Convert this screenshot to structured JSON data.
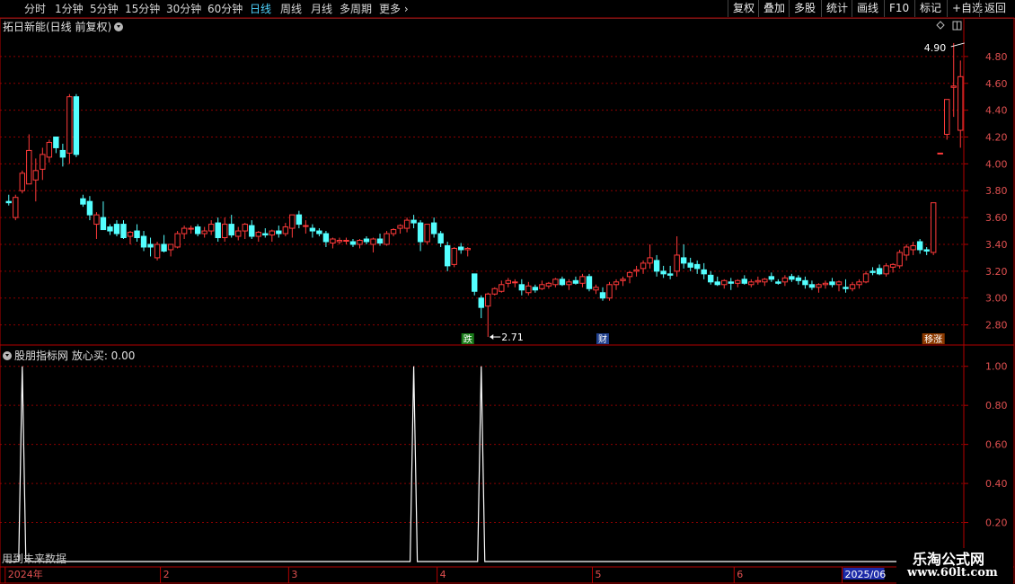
{
  "toolbar": {
    "periods": [
      {
        "label": "分时",
        "active": false
      },
      {
        "label": "1分钟",
        "active": false
      },
      {
        "label": "5分钟",
        "active": false
      },
      {
        "label": "15分钟",
        "active": false
      },
      {
        "label": "30分钟",
        "active": false
      },
      {
        "label": "60分钟",
        "active": false
      },
      {
        "label": "日线",
        "active": true
      },
      {
        "label": "周线",
        "active": false
      },
      {
        "label": "月线",
        "active": false
      },
      {
        "label": "多周期",
        "active": false
      },
      {
        "label": "更多",
        "active": false
      }
    ],
    "buttons": [
      "复权",
      "叠加",
      "多股",
      "统计",
      "画线",
      "F10",
      "标记",
      "+自选",
      "返回"
    ]
  },
  "stock": {
    "title": "拓日新能(日线 前复权)"
  },
  "indicator": {
    "title": "股朋指标网  放心买: 0.00"
  },
  "future_data_label": "用到未来数据",
  "watermark": {
    "name": "乐淘公式网",
    "url": "www.60lt.com"
  },
  "colors": {
    "up": "#ff3a3a",
    "down": "#54ffff",
    "grid": "#8b0000",
    "axis": "#b40000",
    "text": "#e05050",
    "white": "#ffffff"
  },
  "events": [
    {
      "label": "跌",
      "bg": "#1a7d1a",
      "color": "#ffffff",
      "index": 68
    },
    {
      "label": "财",
      "bg": "#1f3f8c",
      "color": "#ffffff",
      "index": 88
    },
    {
      "label": "移涨",
      "bg": "#8c3a00",
      "color": "#ffffff",
      "index": 137
    }
  ],
  "chart_data": [
    {
      "type": "candlestick",
      "title": "拓日新能(日线 前复权)",
      "ylim": [
        2.65,
        4.98
      ],
      "y_ticks": [
        2.8,
        3.0,
        3.2,
        3.4,
        3.6,
        3.8,
        4.0,
        4.2,
        4.4,
        4.6,
        4.8
      ],
      "annotations": [
        {
          "text": "4.90",
          "candle": 142,
          "value": 4.9
        },
        {
          "text": "2.71",
          "candle": 71,
          "value": 2.71
        }
      ],
      "candles": [
        [
          3.72,
          3.77,
          3.69,
          3.71
        ],
        [
          3.6,
          3.77,
          3.58,
          3.75
        ],
        [
          3.8,
          3.95,
          3.78,
          3.93
        ],
        [
          3.85,
          4.22,
          3.85,
          4.1
        ],
        [
          3.88,
          4.04,
          3.72,
          3.95
        ],
        [
          3.96,
          4.12,
          3.88,
          4.07
        ],
        [
          4.05,
          4.18,
          4.01,
          4.16
        ],
        [
          4.2,
          4.2,
          4.08,
          4.12
        ],
        [
          4.1,
          4.15,
          3.98,
          4.05
        ],
        [
          4.08,
          4.52,
          4.0,
          4.5
        ],
        [
          4.5,
          4.52,
          4.05,
          4.07
        ],
        [
          3.74,
          3.77,
          3.68,
          3.7
        ],
        [
          3.72,
          3.76,
          3.58,
          3.62
        ],
        [
          3.55,
          3.64,
          3.44,
          3.62
        ],
        [
          3.6,
          3.72,
          3.55,
          3.51
        ],
        [
          3.53,
          3.55,
          3.47,
          3.5
        ],
        [
          3.55,
          3.58,
          3.46,
          3.48
        ],
        [
          3.55,
          3.58,
          3.44,
          3.45
        ],
        [
          3.46,
          3.5,
          3.4,
          3.49
        ],
        [
          3.5,
          3.55,
          3.42,
          3.45
        ],
        [
          3.46,
          3.5,
          3.35,
          3.38
        ],
        [
          3.4,
          3.45,
          3.31,
          3.38
        ],
        [
          3.3,
          3.42,
          3.28,
          3.4
        ],
        [
          3.4,
          3.47,
          3.34,
          3.35
        ],
        [
          3.36,
          3.4,
          3.31,
          3.4
        ],
        [
          3.38,
          3.5,
          3.37,
          3.48
        ],
        [
          3.48,
          3.54,
          3.44,
          3.52
        ],
        [
          3.52,
          3.54,
          3.48,
          3.52
        ],
        [
          3.53,
          3.55,
          3.46,
          3.48
        ],
        [
          3.48,
          3.53,
          3.45,
          3.5
        ],
        [
          3.5,
          3.58,
          3.47,
          3.55
        ],
        [
          3.56,
          3.6,
          3.42,
          3.45
        ],
        [
          3.45,
          3.6,
          3.42,
          3.55
        ],
        [
          3.55,
          3.62,
          3.45,
          3.47
        ],
        [
          3.46,
          3.53,
          3.43,
          3.5
        ],
        [
          3.5,
          3.56,
          3.44,
          3.55
        ],
        [
          3.54,
          3.58,
          3.44,
          3.46
        ],
        [
          3.46,
          3.5,
          3.42,
          3.49
        ],
        [
          3.48,
          3.52,
          3.45,
          3.47
        ],
        [
          3.47,
          3.51,
          3.42,
          3.5
        ],
        [
          3.5,
          3.54,
          3.45,
          3.48
        ],
        [
          3.48,
          3.56,
          3.46,
          3.53
        ],
        [
          3.52,
          3.6,
          3.45,
          3.62
        ],
        [
          3.62,
          3.65,
          3.52,
          3.55
        ],
        [
          3.54,
          3.58,
          3.48,
          3.54
        ],
        [
          3.52,
          3.55,
          3.45,
          3.5
        ],
        [
          3.5,
          3.52,
          3.46,
          3.48
        ],
        [
          3.48,
          3.5,
          3.38,
          3.42
        ],
        [
          3.41,
          3.45,
          3.37,
          3.44
        ],
        [
          3.42,
          3.45,
          3.4,
          3.43
        ],
        [
          3.43,
          3.45,
          3.4,
          3.43
        ],
        [
          3.42,
          3.44,
          3.38,
          3.4
        ],
        [
          3.4,
          3.44,
          3.37,
          3.43
        ],
        [
          3.44,
          3.46,
          3.4,
          3.42
        ],
        [
          3.4,
          3.45,
          3.34,
          3.44
        ],
        [
          3.44,
          3.48,
          3.39,
          3.41
        ],
        [
          3.4,
          3.5,
          3.39,
          3.48
        ],
        [
          3.48,
          3.52,
          3.46,
          3.51
        ],
        [
          3.52,
          3.55,
          3.48,
          3.54
        ],
        [
          3.52,
          3.6,
          3.49,
          3.58
        ],
        [
          3.58,
          3.62,
          3.52,
          3.56
        ],
        [
          3.56,
          3.58,
          3.35,
          3.42
        ],
        [
          3.42,
          3.52,
          3.4,
          3.55
        ],
        [
          3.56,
          3.6,
          3.45,
          3.48
        ],
        [
          3.48,
          3.5,
          3.38,
          3.41
        ],
        [
          3.39,
          3.42,
          3.2,
          3.24
        ],
        [
          3.25,
          3.38,
          3.23,
          3.37
        ],
        [
          3.38,
          3.41,
          3.33,
          3.36
        ],
        [
          3.36,
          3.38,
          3.31,
          3.37
        ],
        [
          3.18,
          3.18,
          3.02,
          3.05
        ],
        [
          3.0,
          3.02,
          2.85,
          2.93
        ],
        [
          2.94,
          3.04,
          2.71,
          3.03
        ],
        [
          3.03,
          3.08,
          3.02,
          3.07
        ],
        [
          3.05,
          3.13,
          3.04,
          3.1
        ],
        [
          3.11,
          3.15,
          3.08,
          3.13
        ],
        [
          3.12,
          3.14,
          3.08,
          3.12
        ],
        [
          3.1,
          3.14,
          3.02,
          3.06
        ],
        [
          3.04,
          3.12,
          3.02,
          3.09
        ],
        [
          3.08,
          3.1,
          3.04,
          3.06
        ],
        [
          3.07,
          3.13,
          3.06,
          3.1
        ],
        [
          3.09,
          3.12,
          3.07,
          3.11
        ],
        [
          3.1,
          3.15,
          3.08,
          3.14
        ],
        [
          3.14,
          3.16,
          3.09,
          3.1
        ],
        [
          3.1,
          3.14,
          3.06,
          3.12
        ],
        [
          3.13,
          3.16,
          3.1,
          3.11
        ],
        [
          3.11,
          3.18,
          3.08,
          3.16
        ],
        [
          3.16,
          3.18,
          3.05,
          3.07
        ],
        [
          3.06,
          3.1,
          3.03,
          3.08
        ],
        [
          3.04,
          3.08,
          2.98,
          3.0
        ],
        [
          3.0,
          3.12,
          2.98,
          3.1
        ],
        [
          3.1,
          3.14,
          3.06,
          3.12
        ],
        [
          3.13,
          3.16,
          3.09,
          3.14
        ],
        [
          3.16,
          3.2,
          3.11,
          3.19
        ],
        [
          3.2,
          3.24,
          3.16,
          3.21
        ],
        [
          3.22,
          3.28,
          3.18,
          3.26
        ],
        [
          3.26,
          3.4,
          3.22,
          3.3
        ],
        [
          3.28,
          3.32,
          3.16,
          3.2
        ],
        [
          3.2,
          3.24,
          3.15,
          3.18
        ],
        [
          3.18,
          3.24,
          3.14,
          3.17
        ],
        [
          3.2,
          3.46,
          3.16,
          3.32
        ],
        [
          3.3,
          3.4,
          3.22,
          3.26
        ],
        [
          3.26,
          3.3,
          3.2,
          3.23
        ],
        [
          3.25,
          3.28,
          3.18,
          3.22
        ],
        [
          3.21,
          3.26,
          3.14,
          3.18
        ],
        [
          3.17,
          3.2,
          3.1,
          3.12
        ],
        [
          3.12,
          3.16,
          3.09,
          3.1
        ],
        [
          3.1,
          3.14,
          3.07,
          3.13
        ],
        [
          3.12,
          3.15,
          3.06,
          3.11
        ],
        [
          3.11,
          3.14,
          3.08,
          3.13
        ],
        [
          3.14,
          3.17,
          3.1,
          3.11
        ],
        [
          3.1,
          3.14,
          3.08,
          3.12
        ],
        [
          3.12,
          3.16,
          3.1,
          3.13
        ],
        [
          3.12,
          3.15,
          3.09,
          3.14
        ],
        [
          3.16,
          3.19,
          3.12,
          3.14
        ],
        [
          3.12,
          3.14,
          3.1,
          3.11
        ],
        [
          3.12,
          3.17,
          3.09,
          3.15
        ],
        [
          3.16,
          3.18,
          3.12,
          3.14
        ],
        [
          3.15,
          3.17,
          3.1,
          3.13
        ],
        [
          3.13,
          3.16,
          3.07,
          3.1
        ],
        [
          3.1,
          3.13,
          3.06,
          3.08
        ],
        [
          3.08,
          3.11,
          3.04,
          3.1
        ],
        [
          3.1,
          3.13,
          3.07,
          3.11
        ],
        [
          3.12,
          3.15,
          3.08,
          3.1
        ],
        [
          3.1,
          3.13,
          3.05,
          3.12
        ],
        [
          3.08,
          3.14,
          3.04,
          3.07
        ],
        [
          3.07,
          3.12,
          3.05,
          3.1
        ],
        [
          3.1,
          3.14,
          3.07,
          3.12
        ],
        [
          3.12,
          3.2,
          3.11,
          3.18
        ],
        [
          3.2,
          3.23,
          3.17,
          3.19
        ],
        [
          3.22,
          3.25,
          3.17,
          3.18
        ],
        [
          3.18,
          3.26,
          3.16,
          3.24
        ],
        [
          3.23,
          3.26,
          3.19,
          3.25
        ],
        [
          3.24,
          3.36,
          3.22,
          3.34
        ],
        [
          3.32,
          3.4,
          3.28,
          3.38
        ],
        [
          3.36,
          3.42,
          3.32,
          3.39
        ],
        [
          3.42,
          3.44,
          3.33,
          3.36
        ],
        [
          3.36,
          3.38,
          3.32,
          3.35
        ],
        [
          3.34,
          3.71,
          3.32,
          3.71
        ],
        [
          4.08,
          4.08,
          4.08,
          4.08
        ],
        [
          4.22,
          4.48,
          4.18,
          4.48
        ],
        [
          4.57,
          4.9,
          4.35,
          4.58
        ],
        [
          4.25,
          4.77,
          4.12,
          4.65
        ]
      ]
    },
    {
      "type": "line",
      "title": "股朋指标网  放心买: 0.00",
      "ylim": [
        0,
        1.1
      ],
      "y_ticks": [
        0.2,
        0.4,
        0.6,
        0.8,
        1.0
      ],
      "spikes": [
        {
          "candle": 2,
          "value": 1.0
        },
        {
          "candle": 60,
          "value": 1.0
        },
        {
          "candle": 70,
          "value": 1.0
        }
      ]
    }
  ],
  "time_axis": {
    "labels": [
      {
        "text": "2024年",
        "candle": 0,
        "boxed": false
      },
      {
        "text": "2",
        "candle": 23,
        "boxed": false
      },
      {
        "text": "3",
        "candle": 42,
        "boxed": false
      },
      {
        "text": "4",
        "candle": 64,
        "boxed": false
      },
      {
        "text": "5",
        "candle": 87,
        "boxed": false
      },
      {
        "text": "6",
        "candle": 108,
        "boxed": false
      },
      {
        "text": "2025/06",
        "candle": 124,
        "boxed": true
      }
    ]
  }
}
